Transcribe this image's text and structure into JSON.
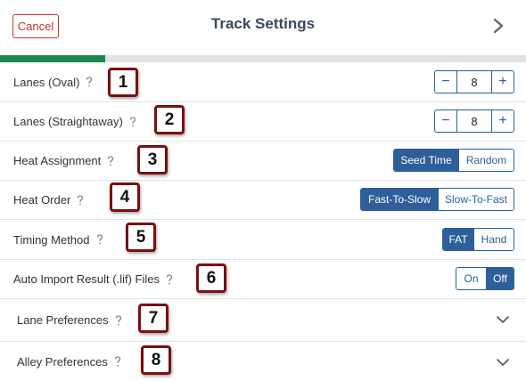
{
  "header": {
    "cancel_label": "Cancel",
    "title": "Track Settings",
    "progress_fraction": 0.2
  },
  "rows": {
    "lanes_oval": {
      "label": "Lanes (Oval)",
      "value": "8",
      "badge": "1"
    },
    "lanes_straight": {
      "label": "Lanes (Straightaway)",
      "value": "8",
      "badge": "2"
    },
    "heat_assignment": {
      "label": "Heat Assignment",
      "options": [
        "Seed Time",
        "Random"
      ],
      "selected": "Seed Time",
      "badge": "3"
    },
    "heat_order": {
      "label": "Heat Order",
      "options": [
        "Fast-To-Slow",
        "Slow-To-Fast"
      ],
      "selected": "Fast-To-Slow",
      "badge": "4"
    },
    "timing_method": {
      "label": "Timing Method",
      "options": [
        "FAT",
        "Hand"
      ],
      "selected": "FAT",
      "badge": "5"
    },
    "auto_import": {
      "label": "Auto Import Result (.lif) Files",
      "options": [
        "On",
        "Off"
      ],
      "selected": "Off",
      "badge": "6"
    },
    "lane_prefs": {
      "label": "Lane Preferences",
      "badge": "7"
    },
    "alley_prefs": {
      "label": "Alley Preferences",
      "badge": "8"
    }
  },
  "stepper": {
    "minus": "−",
    "plus": "+"
  },
  "icons": {
    "help": "question-mark-icon",
    "next": "chevron-right-icon",
    "expand": "chevron-down-icon"
  },
  "colors": {
    "accent": "#2e5f9a",
    "cancel": "#c9302c",
    "progress": "#1a8a4e",
    "badge_border": "#7a1010"
  }
}
